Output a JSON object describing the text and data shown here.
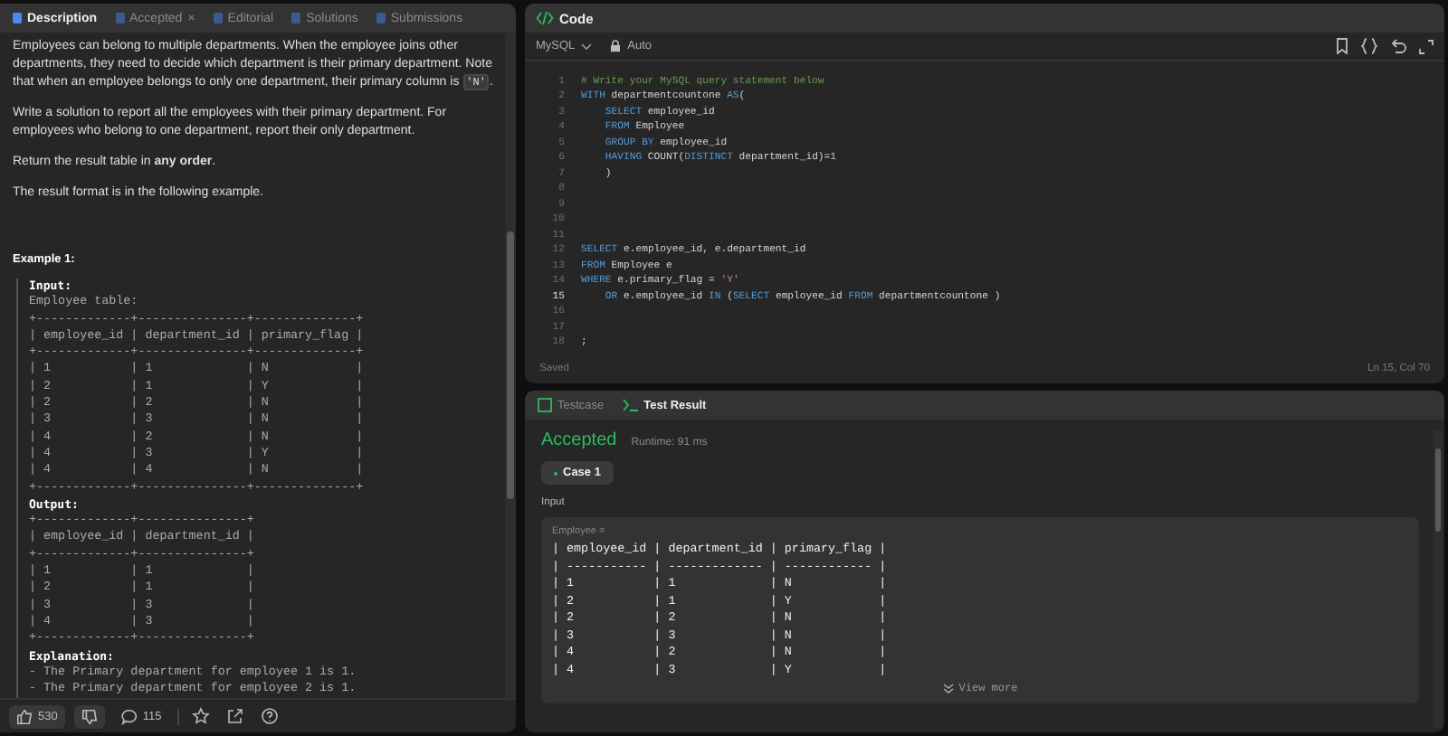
{
  "left_tabs": [
    {
      "label": "Description",
      "selected": true,
      "closable": false
    },
    {
      "label": "Accepted",
      "selected": false,
      "closable": true
    },
    {
      "label": "Editorial",
      "selected": false,
      "closable": false
    },
    {
      "label": "Solutions",
      "selected": false,
      "closable": false
    },
    {
      "label": "Submissions",
      "selected": false,
      "closable": false
    }
  ],
  "close_glyph": "×",
  "paragraphs": [
    [
      {
        "kind": "text",
        "text": "Employees can belong to multiple departments. When the employee joins other departments, they need to decide which department is their primary department. Note that when an employee belongs to only one department, their primary column is "
      },
      {
        "kind": "code",
        "text": "'N'"
      },
      {
        "kind": "text",
        "text": "."
      }
    ],
    [
      {
        "kind": "text",
        "text": "Write a solution to report all the employees with their primary department. For employees who belong to one department, report their only department."
      }
    ],
    [
      {
        "kind": "text",
        "text": "Return the result table in **any order**."
      }
    ],
    [
      {
        "kind": "text",
        "text": "The result format is in the following example."
      }
    ]
  ],
  "example": {
    "title": "Example 1:",
    "lines": [
      {
        "kind": "heading",
        "text": "Input:"
      },
      {
        "kind": "plain",
        "text": "Employee table:"
      },
      {
        "kind": "plain",
        "text": "+-------------+---------------+--------------+"
      },
      {
        "kind": "plain",
        "text": "| employee_id | department_id | primary_flag |"
      },
      {
        "kind": "plain",
        "text": "+-------------+---------------+--------------+"
      },
      {
        "kind": "plain",
        "text": "| 1           | 1             | N            |"
      },
      {
        "kind": "plain",
        "text": "| 2           | 1             | Y            |"
      },
      {
        "kind": "plain",
        "text": "| 2           | 2             | N            |"
      },
      {
        "kind": "plain",
        "text": "| 3           | 3             | N            |"
      },
      {
        "kind": "plain",
        "text": "| 4           | 2             | N            |"
      },
      {
        "kind": "plain",
        "text": "| 4           | 3             | Y            |"
      },
      {
        "kind": "plain",
        "text": "| 4           | 4             | N            |"
      },
      {
        "kind": "plain",
        "text": "+-------------+---------------+--------------+"
      },
      {
        "kind": "heading",
        "text": "Output:"
      },
      {
        "kind": "plain",
        "text": "+-------------+---------------+"
      },
      {
        "kind": "plain",
        "text": "| employee_id | department_id |"
      },
      {
        "kind": "plain",
        "text": "+-------------+---------------+"
      },
      {
        "kind": "plain",
        "text": "| 1           | 1             |"
      },
      {
        "kind": "plain",
        "text": "| 2           | 1             |"
      },
      {
        "kind": "plain",
        "text": "| 3           | 3             |"
      },
      {
        "kind": "plain",
        "text": "| 4           | 3             |"
      },
      {
        "kind": "plain",
        "text": "+-------------+---------------+"
      },
      {
        "kind": "heading",
        "text": "Explanation:"
      },
      {
        "kind": "plain",
        "text": "- The Primary department for employee 1 is 1."
      },
      {
        "kind": "plain",
        "text": "- The Primary department for employee 2 is 1."
      }
    ]
  },
  "footer": {
    "likes": "530",
    "comments": "115"
  },
  "code_panel": {
    "title": "Code",
    "language": "MySQL",
    "mode": "Auto",
    "status": "Saved",
    "cursor": "Ln 15, Col 70",
    "lines": [
      {
        "number": "1",
        "current": false,
        "tokens": [
          {
            "kind": "comment",
            "text": "# Write your MySQL query statement below"
          }
        ]
      },
      {
        "number": "2",
        "current": false,
        "tokens": [
          {
            "kind": "keyword",
            "text": "WITH"
          },
          {
            "kind": "plain",
            "text": " departmentcountone "
          },
          {
            "kind": "keyword",
            "text": "AS"
          },
          {
            "kind": "plain",
            "text": "("
          }
        ]
      },
      {
        "number": "3",
        "current": false,
        "tokens": [
          {
            "kind": "keyword",
            "text": "    SELECT"
          },
          {
            "kind": "plain",
            "text": " employee_id"
          }
        ]
      },
      {
        "number": "4",
        "current": false,
        "tokens": [
          {
            "kind": "keyword",
            "text": "    FROM"
          },
          {
            "kind": "plain",
            "text": " Employee"
          }
        ]
      },
      {
        "number": "5",
        "current": false,
        "tokens": [
          {
            "kind": "keyword",
            "text": "    GROUP BY"
          },
          {
            "kind": "plain",
            "text": " employee_id"
          }
        ]
      },
      {
        "number": "6",
        "current": false,
        "tokens": [
          {
            "kind": "keyword",
            "text": "    HAVING"
          },
          {
            "kind": "plain",
            "text": " COUNT("
          },
          {
            "kind": "keyword",
            "text": "DISTINCT"
          },
          {
            "kind": "plain",
            "text": " department_id)="
          },
          {
            "kind": "number",
            "text": "1"
          }
        ]
      },
      {
        "number": "7",
        "current": false,
        "tokens": [
          {
            "kind": "plain",
            "text": "    )"
          }
        ]
      },
      {
        "number": "8",
        "current": false
      },
      {
        "number": "9",
        "current": false
      },
      {
        "number": "10",
        "current": false
      },
      {
        "number": "11",
        "current": false
      },
      {
        "number": "12",
        "current": false,
        "tokens": [
          {
            "kind": "keyword",
            "text": "SELECT"
          },
          {
            "kind": "plain",
            "text": " e.employee_id, e.department_id"
          }
        ]
      },
      {
        "number": "13",
        "current": false,
        "tokens": [
          {
            "kind": "keyword",
            "text": "FROM"
          },
          {
            "kind": "plain",
            "text": " Employee e"
          }
        ]
      },
      {
        "number": "14",
        "current": false,
        "tokens": [
          {
            "kind": "keyword",
            "text": "WHERE"
          },
          {
            "kind": "plain",
            "text": " e.primary_flag = "
          },
          {
            "kind": "string",
            "text": "'Y'"
          }
        ]
      },
      {
        "number": "15",
        "current": true,
        "tokens": [
          {
            "kind": "keyword",
            "text": "    OR"
          },
          {
            "kind": "plain",
            "text": " e.employee_id "
          },
          {
            "kind": "keyword",
            "text": "IN"
          },
          {
            "kind": "plain",
            "text": " ("
          },
          {
            "kind": "keyword",
            "text": "SELECT"
          },
          {
            "kind": "plain",
            "text": " employee_id "
          },
          {
            "kind": "keyword",
            "text": "FROM"
          },
          {
            "kind": "plain",
            "text": " departmentcountone )"
          }
        ]
      },
      {
        "number": "16",
        "current": false
      },
      {
        "number": "17",
        "current": false
      },
      {
        "number": "18",
        "current": false,
        "tokens": [
          {
            "kind": "plain",
            "text": ";"
          }
        ]
      }
    ]
  },
  "result_panel": {
    "tabs": [
      {
        "label": "Testcase",
        "selected": false
      },
      {
        "label": "Test Result",
        "selected": true
      }
    ],
    "verdict": "Accepted",
    "runtime": "Runtime: 91 ms",
    "cases": [
      {
        "label": "Case 1",
        "selected": true
      }
    ],
    "input_label": "Input",
    "table_name": "Employee =",
    "lines": [
      "| employee_id | department_id | primary_flag |",
      "| ----------- | ------------- | ------------ |",
      "| 1           | 1             | N            |",
      "| 2           | 1             | Y            |",
      "| 2           | 2             | N            |",
      "| 3           | 3             | N            |",
      "| 4           | 2             | N            |",
      "| 4           | 3             | Y            |"
    ],
    "view_more": "View more"
  }
}
